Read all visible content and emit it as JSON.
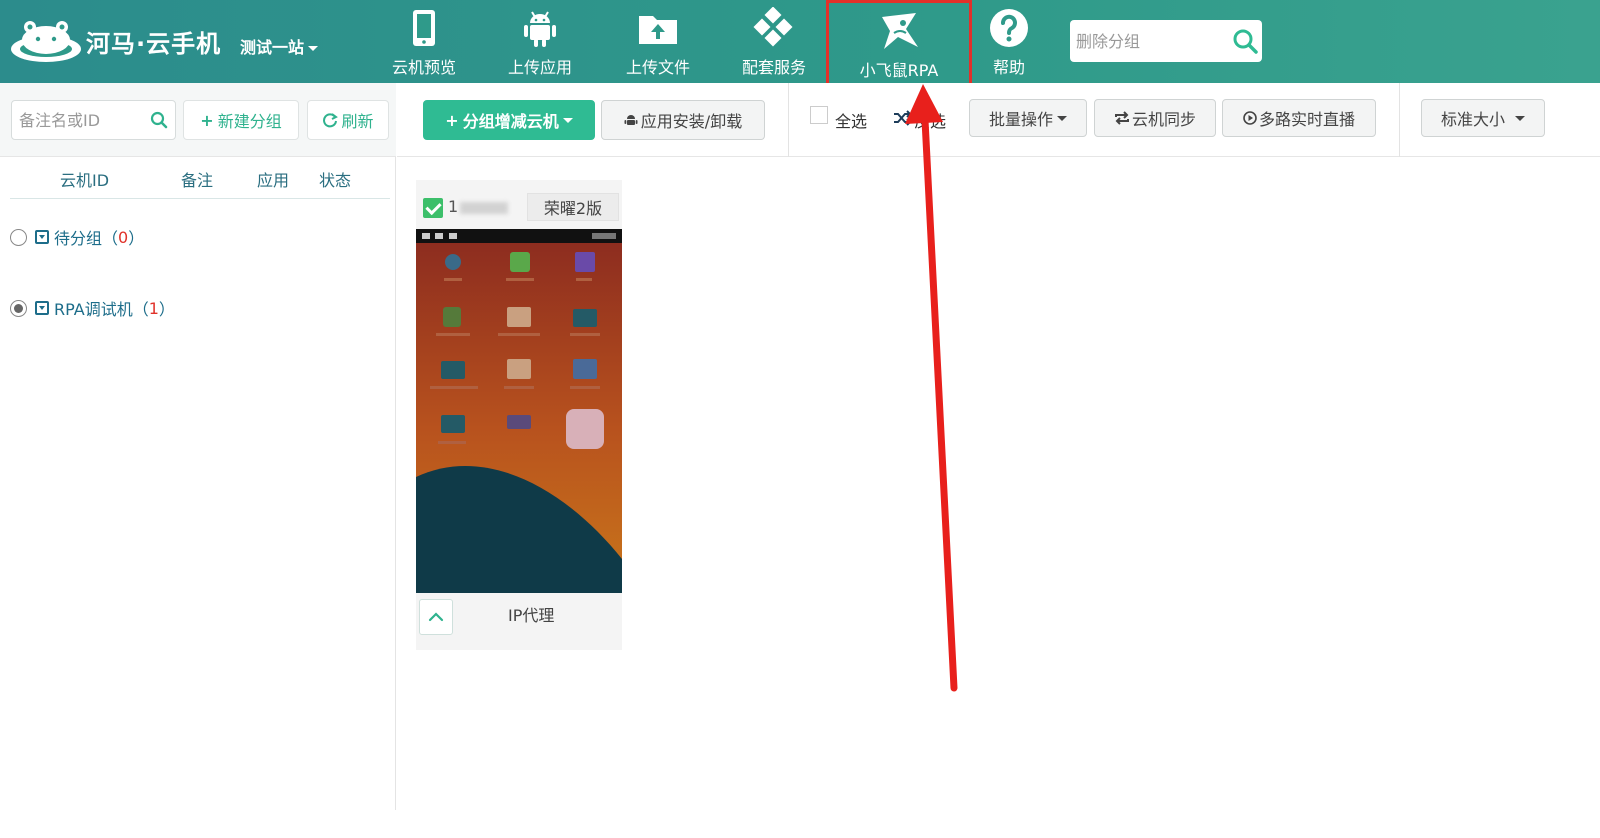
{
  "app": {
    "logo_text": "河马·云手机",
    "site_selector": "测试一站"
  },
  "nav": [
    {
      "label": "云机预览",
      "icon": "phone-icon"
    },
    {
      "label": "上传应用",
      "icon": "android-icon"
    },
    {
      "label": "上传文件",
      "icon": "folder-upload-icon"
    },
    {
      "label": "配套服务",
      "icon": "diamond-grid-icon"
    },
    {
      "label": "小飞鼠RPA",
      "icon": "flying-squirrel-icon",
      "highlighted": true
    },
    {
      "label": "帮助",
      "icon": "help-icon"
    }
  ],
  "top_search": {
    "placeholder": "删除分组",
    "icon": "search-icon"
  },
  "left_panel": {
    "search_placeholder": "备注名或ID",
    "new_group_label": "新建分组",
    "refresh_label": "刷新",
    "columns": [
      "云机ID",
      "备注",
      "应用",
      "状态"
    ],
    "groups": [
      {
        "name": "待分组",
        "count": "0",
        "selected": false
      },
      {
        "name": "RPA调试机",
        "count": "1",
        "selected": true
      }
    ]
  },
  "toolbar": {
    "group_add_remove_label": "分组增减云机",
    "app_install_label": "应用安装/卸载",
    "select_all_label": "全选",
    "invert_select_label": "反选",
    "batch_ops_label": "批量操作",
    "sync_label": "云机同步",
    "live_label": "多路实时直播",
    "size_label": "标准大小"
  },
  "device": {
    "id_prefix": "1",
    "model": "荣曜2版",
    "proxy_label": "IP代理",
    "checked": true
  },
  "colors": {
    "header": "#2f9a8a",
    "accent": "#2fbb93",
    "highlight_box": "#e3302a",
    "annotation_arrow": "#e8201c"
  }
}
